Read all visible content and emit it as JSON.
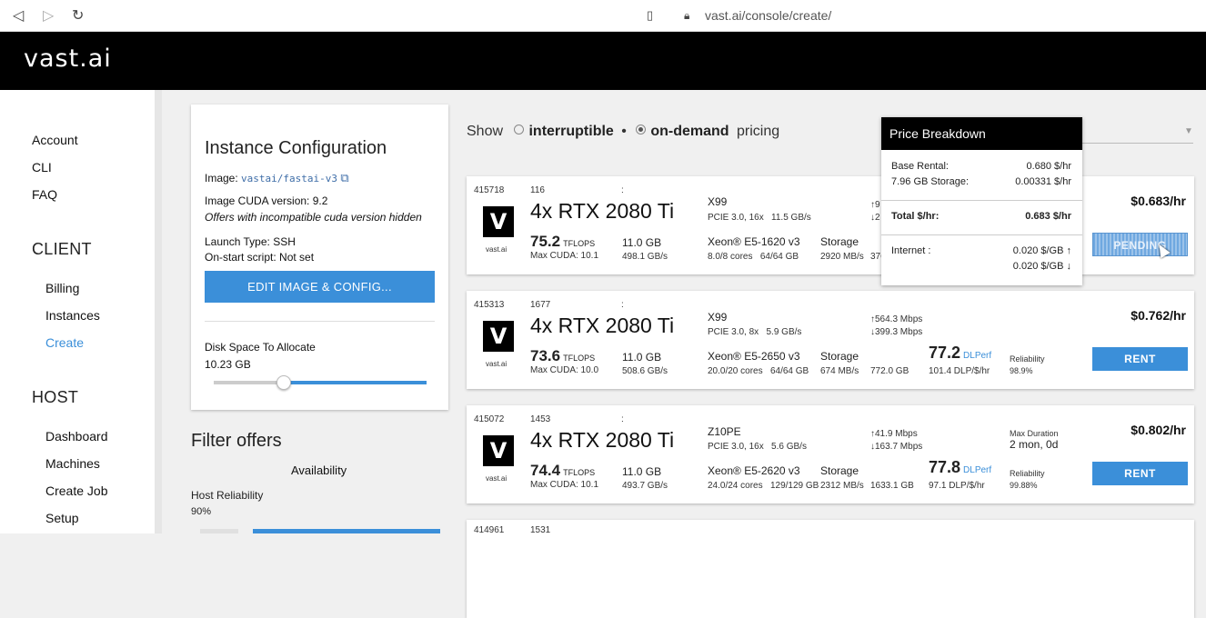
{
  "browser": {
    "back_icon": "back-arrow-icon",
    "forward_icon": "forward-arrow-icon",
    "reload_icon": "reload-icon",
    "bookmark_icon": "bookmark-icon",
    "lock_icon": "lock-icon",
    "url": "vast.ai/console/create/"
  },
  "header": {
    "logo": "vast.ai"
  },
  "sidebar": {
    "top_items": [
      "Account",
      "CLI",
      "FAQ"
    ],
    "client_title": "CLIENT",
    "client_items": [
      "Billing",
      "Instances",
      "Create"
    ],
    "host_title": "HOST",
    "host_items": [
      "Dashboard",
      "Machines",
      "Create Job",
      "Setup"
    ],
    "active_item": "Create"
  },
  "config": {
    "title": "Instance Configuration",
    "image_label": "Image:",
    "image_value": "vastai/fastai-v3",
    "external_link_icon": "external-link-icon",
    "cuda_label": "Image CUDA version:",
    "cuda_value": "9.2",
    "cuda_note": "Offers with incompatible cuda version hidden",
    "launch_label": "Launch Type:",
    "launch_value": "SSH",
    "onstart_label": "On-start script:",
    "onstart_value": "Not set",
    "edit_button": "EDIT IMAGE & CONFIG...",
    "disk_label": "Disk Space To Allocate",
    "disk_value": "10.23 GB",
    "disk_slider_fraction": 0.33
  },
  "filter": {
    "title": "Filter offers",
    "availability": "Availability",
    "host_reliability_label": "Host Reliability",
    "host_reliability_value": "90%"
  },
  "show": {
    "label": "Show",
    "option1": "interruptible",
    "separator": "•",
    "option2": "on-demand",
    "suffix": "pricing",
    "selected": "on-demand"
  },
  "offers": [
    {
      "id": "415718",
      "num": "116",
      "colon": ":",
      "gpu": "4x RTX 2080 Ti",
      "tflops": "75.2",
      "tflops_unit": "TFLOPS",
      "max_cuda": "Max CUDA: 10.1",
      "vram": "11.0 GB",
      "bandwidth": "498.1 GB/s",
      "mobo": "X99",
      "pcie": "PCIE 3.0, 16x",
      "pcie_bw": "11.5 GB/s",
      "cpu": "Xeon® E5-1620 v3",
      "cores": "8.0/8 cores",
      "ram": "64/64 GB",
      "storage": "Storage",
      "disk_speed": "2920 MB/s",
      "disk_size": "376",
      "net_up": "↑9",
      "net_down": "↓2",
      "price": "$0.683/hr",
      "button": "PENDING"
    },
    {
      "id": "415313",
      "num": "1677",
      "colon": ":",
      "gpu": "4x RTX 2080 Ti",
      "tflops": "73.6",
      "tflops_unit": "TFLOPS",
      "max_cuda": "Max CUDA: 10.0",
      "vram": "11.0 GB",
      "bandwidth": "508.6 GB/s",
      "mobo": "X99",
      "pcie": "PCIE 3.0, 8x",
      "pcie_bw": "5.9 GB/s",
      "cpu": "Xeon® E5-2650 v3",
      "cores": "20.0/20 cores",
      "ram": "64/64 GB",
      "storage": "Storage",
      "disk_speed": "674 MB/s",
      "disk_size": "772.0 GB",
      "net_up": "↑564.3 Mbps",
      "net_down": "↓399.3 Mbps",
      "dlperf": "77.2",
      "dlperf_unit": "DLPerf",
      "dlp_per_dollar": "101.4 DLP/$/hr",
      "reliability_label": "Reliability",
      "reliability": "98.9%",
      "price": "$0.762/hr",
      "button": "RENT"
    },
    {
      "id": "415072",
      "num": "1453",
      "colon": ":",
      "gpu": "4x RTX 2080 Ti",
      "tflops": "74.4",
      "tflops_unit": "TFLOPS",
      "max_cuda": "Max CUDA: 10.1",
      "vram": "11.0 GB",
      "bandwidth": "493.7 GB/s",
      "mobo": "Z10PE",
      "pcie": "PCIE 3.0, 16x",
      "pcie_bw": "5.6 GB/s",
      "cpu": "Xeon® E5-2620 v3",
      "cores": "24.0/24 cores",
      "ram": "129/129 GB",
      "storage": "Storage",
      "disk_speed": "2312 MB/s",
      "disk_size": "1633.1 GB",
      "net_up": "↑41.9 Mbps",
      "net_down": "↓163.7 Mbps",
      "dlperf": "77.8",
      "dlperf_unit": "DLPerf",
      "dlp_per_dollar": "97.1 DLP/$/hr",
      "reliability_label": "Reliability",
      "reliability": "99.88%",
      "duration_label": "Max Duration",
      "duration": "2 mon, 0d",
      "price": "$0.802/hr",
      "button": "RENT"
    },
    {
      "id": "414961",
      "num": "1531"
    }
  ],
  "logo_caption": "vast.ai",
  "tooltip": {
    "title": "Price Breakdown",
    "base_label": "Base Rental:",
    "base_value": "0.680 $/hr",
    "storage_label": "7.96 GB Storage:",
    "storage_value": "0.00331 $/hr",
    "total_label": "Total $/hr:",
    "total_value": "0.683 $/hr",
    "internet_label": "Internet :",
    "internet_up": "0.020 $/GB",
    "internet_down": "0.020 $/GB"
  },
  "colors": {
    "accent": "#3b8fd9",
    "header_bg": "#000000"
  }
}
